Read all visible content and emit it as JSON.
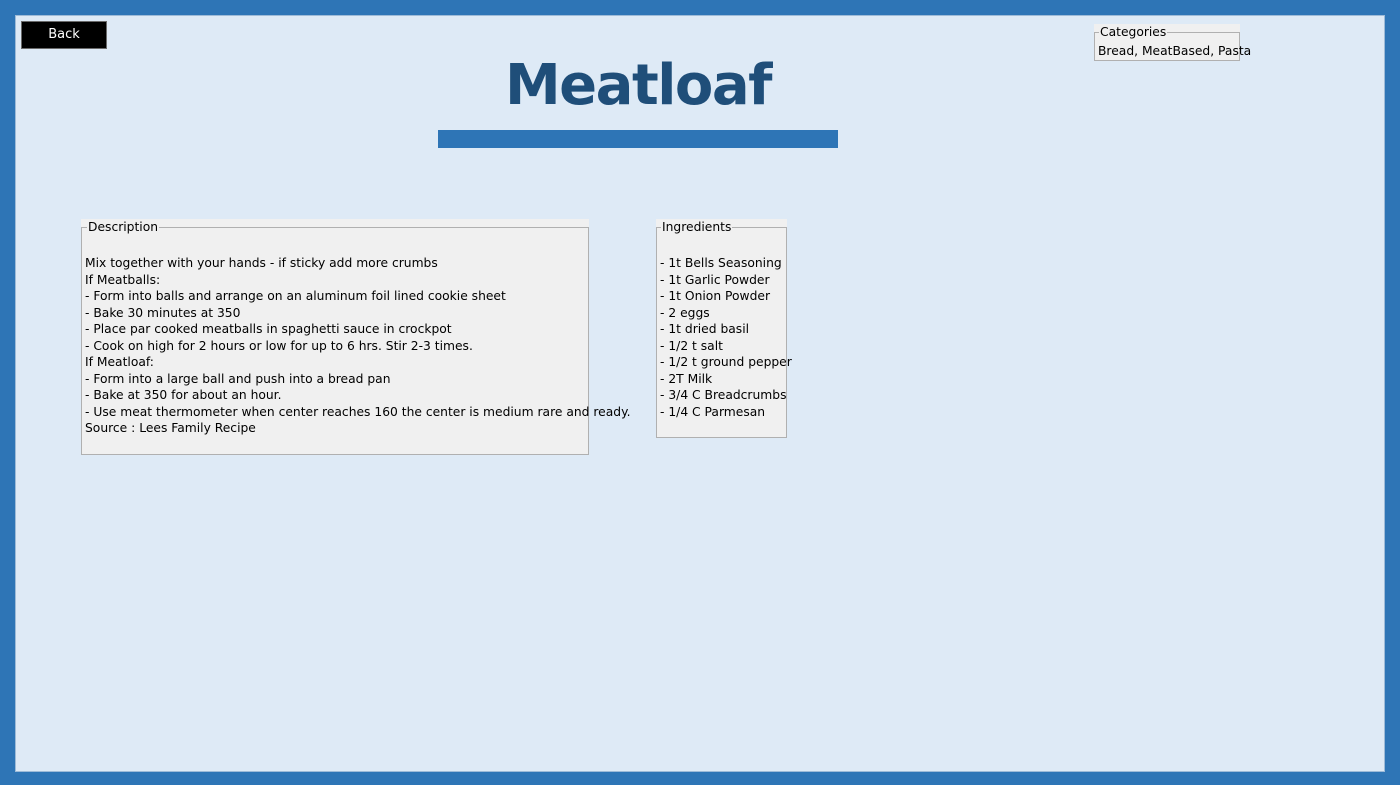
{
  "header": {
    "back_label": "Back",
    "title": "Meatloaf"
  },
  "categories": {
    "legend": "Categories",
    "value": "Bread, MeatBased, Pasta"
  },
  "description": {
    "legend": "Description",
    "lines": [
      "Mix together with your hands - if sticky add more crumbs",
      "If Meatballs:",
      "- Form into balls and arrange on an aluminum foil lined cookie sheet",
      "- Bake 30 minutes at 350",
      "- Place par cooked meatballs in spaghetti sauce in crockpot",
      "- Cook on high for 2 hours or low for up to 6 hrs. Stir 2-3 times.",
      "If Meatloaf:",
      "- Form into a large ball and push into a bread pan",
      "- Bake at 350 for about an hour.",
      "- Use meat thermometer when center reaches 160 the center is medium rare and ready.",
      "Source : Lees Family Recipe"
    ]
  },
  "ingredients": {
    "legend": "Ingredients",
    "lines": [
      "- 1t Bells Seasoning",
      "- 1t Garlic Powder",
      "- 1t Onion Powder",
      "- 2 eggs",
      "- 1t dried basil",
      "- 1/2 t salt",
      "- 1/2 t ground pepper",
      "- 2T Milk",
      "- 3/4 C Breadcrumbs",
      "- 1/4 C Parmesan"
    ]
  },
  "colors": {
    "frame": "#2e75b6",
    "window_background": "#deeaf6",
    "title_text": "#1f4e79",
    "title_bar": "#2e75b6",
    "back_button": "#000000"
  }
}
